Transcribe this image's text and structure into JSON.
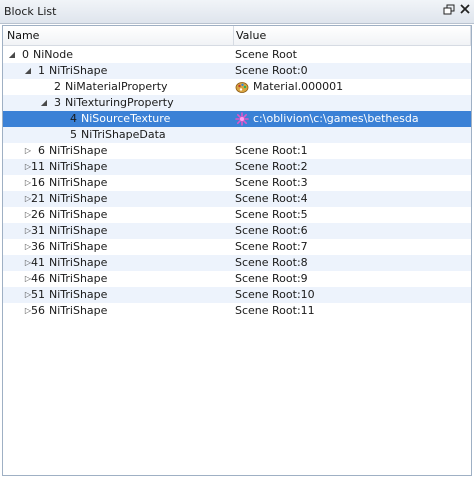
{
  "window": {
    "title": "Block List"
  },
  "header": {
    "name": "Name",
    "value": "Value"
  },
  "rows": [
    {
      "num": "0",
      "name": "NiNode",
      "value": "Scene Root",
      "arrow": "◢"
    },
    {
      "num": "1",
      "name": "NiTriShape",
      "value": "Scene Root:0",
      "arrow": "◢"
    },
    {
      "num": "2",
      "name": "NiMaterialProperty",
      "value": "Material.000001",
      "arrow": "",
      "icon": "palette-icon"
    },
    {
      "num": "3",
      "name": "NiTexturingProperty",
      "value": "",
      "arrow": "◢"
    },
    {
      "num": "4",
      "name": "NiSourceTexture",
      "value": "c:\\oblivion\\c:\\games\\bethesda",
      "arrow": "",
      "icon": "texture-icon",
      "selected": true
    },
    {
      "num": "5",
      "name": "NiTriShapeData",
      "value": "",
      "arrow": ""
    },
    {
      "num": "6",
      "name": "NiTriShape",
      "value": "Scene Root:1",
      "arrow": "▷"
    },
    {
      "num": "11",
      "name": "NiTriShape",
      "value": "Scene Root:2",
      "arrow": "▷"
    },
    {
      "num": "16",
      "name": "NiTriShape",
      "value": "Scene Root:3",
      "arrow": "▷"
    },
    {
      "num": "21",
      "name": "NiTriShape",
      "value": "Scene Root:4",
      "arrow": "▷"
    },
    {
      "num": "26",
      "name": "NiTriShape",
      "value": "Scene Root:5",
      "arrow": "▷"
    },
    {
      "num": "31",
      "name": "NiTriShape",
      "value": "Scene Root:6",
      "arrow": "▷"
    },
    {
      "num": "36",
      "name": "NiTriShape",
      "value": "Scene Root:7",
      "arrow": "▷"
    },
    {
      "num": "41",
      "name": "NiTriShape",
      "value": "Scene Root:8",
      "arrow": "▷"
    },
    {
      "num": "46",
      "name": "NiTriShape",
      "value": "Scene Root:9",
      "arrow": "▷"
    },
    {
      "num": "51",
      "name": "NiTriShape",
      "value": "Scene Root:10",
      "arrow": "▷"
    },
    {
      "num": "56",
      "name": "NiTriShape",
      "value": "Scene Root:11",
      "arrow": "▷"
    }
  ],
  "colors": {
    "selection": "#3b81d6",
    "alt_row": "#edf3fc"
  },
  "icons": {
    "restore": "restore-window-icon",
    "close": "close-icon"
  }
}
